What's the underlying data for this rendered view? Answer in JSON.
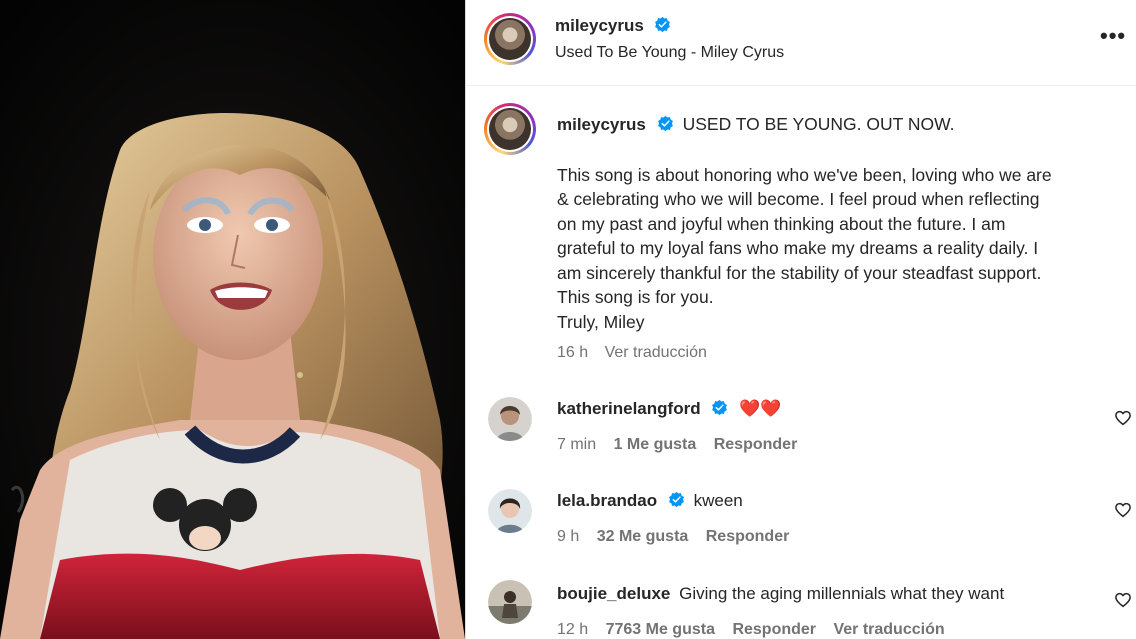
{
  "header": {
    "username": "mileycyrus",
    "subtitle": "Used To Be Young - Miley Cyrus",
    "more_label": "•••"
  },
  "caption": {
    "username": "mileycyrus",
    "headline": "USED TO BE YOUNG. OUT NOW.",
    "body_lines": [
      "This song is about honoring who we've been, loving who we are",
      "& celebrating who we will become. I feel proud when reflecting",
      "on my past and joyful when thinking about the future. I am",
      "grateful to my loyal fans who make my dreams a reality daily. I",
      "am sincerely thankful for the stability of your steadfast support.",
      "This song is for you.",
      "Truly, Miley"
    ],
    "time": "16 h",
    "translate": "Ver traducción"
  },
  "comments": [
    {
      "username": "katherinelangford",
      "verified": true,
      "text": "❤️❤️",
      "time": "7 min",
      "likes": "1 Me gusta",
      "reply": "Responder"
    },
    {
      "username": "lela.brandao",
      "verified": true,
      "text": "kween",
      "time": "9 h",
      "likes": "32 Me gusta",
      "reply": "Responder"
    },
    {
      "username": "boujie_deluxe",
      "verified": false,
      "text": "Giving the aging millennials what they want",
      "time": "12 h",
      "likes": "7763 Me gusta",
      "reply": "Responder",
      "translate": "Ver traducción"
    }
  ],
  "icons": {
    "verified": "verified-badge-icon",
    "like": "heart-outline-icon",
    "more": "more-options-icon"
  },
  "colors": {
    "verified_blue": "#0095f6",
    "meta_gray": "#737373",
    "text": "#262626",
    "heart_red": "#ed4956"
  }
}
